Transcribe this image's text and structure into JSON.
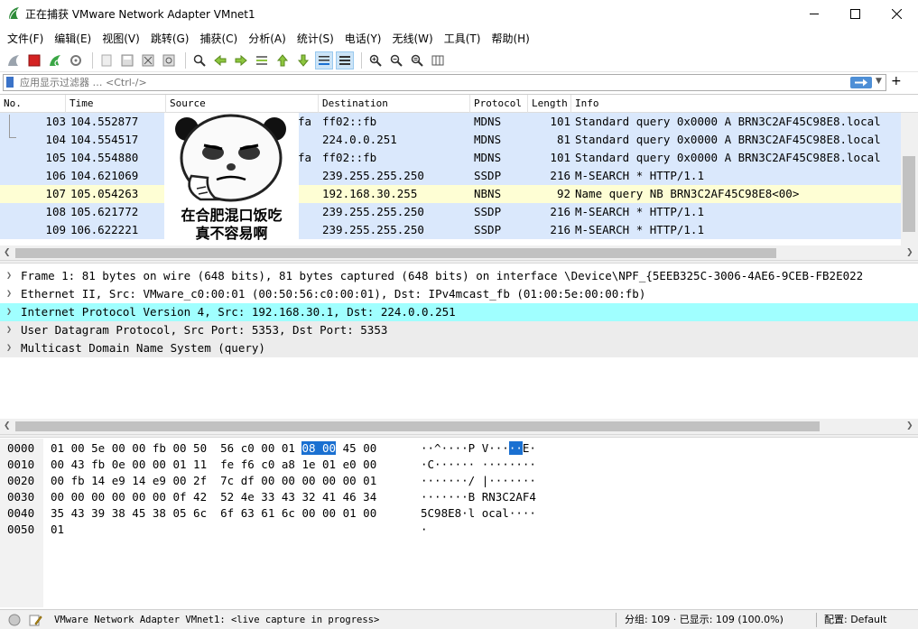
{
  "window": {
    "title": "正在捕获 VMware Network Adapter VMnet1",
    "minimize": "—",
    "maximize": "☐",
    "close": "✕"
  },
  "menu": [
    "文件(F)",
    "编辑(E)",
    "视图(V)",
    "跳转(G)",
    "捕获(C)",
    "分析(A)",
    "统计(S)",
    "电话(Y)",
    "无线(W)",
    "工具(T)",
    "帮助(H)"
  ],
  "filter": {
    "placeholder": "应用显示过滤器 … <Ctrl-/>",
    "apply_icon": "arrow-right-icon",
    "add_label": "+"
  },
  "columns": {
    "no": "No.",
    "time": "Time",
    "source": "Source",
    "destination": "Destination",
    "protocol": "Protocol",
    "length": "Length",
    "info": "Info"
  },
  "packets": [
    {
      "no": "103",
      "time": "104.552877",
      "src": "fa",
      "dst": "ff02::fb",
      "proto": "MDNS",
      "len": "101",
      "info": "Standard query 0x0000 A BRN3C2AF45C98E8.local"
    },
    {
      "no": "104",
      "time": "104.554517",
      "src": "",
      "dst": "224.0.0.251",
      "proto": "MDNS",
      "len": "81",
      "info": "Standard query 0x0000 A BRN3C2AF45C98E8.local"
    },
    {
      "no": "105",
      "time": "104.554880",
      "src": "fa",
      "dst": "ff02::fb",
      "proto": "MDNS",
      "len": "101",
      "info": "Standard query 0x0000 A BRN3C2AF45C98E8.local"
    },
    {
      "no": "106",
      "time": "104.621069",
      "src": "",
      "dst": "239.255.255.250",
      "proto": "SSDP",
      "len": "216",
      "info": "M-SEARCH * HTTP/1.1"
    },
    {
      "no": "107",
      "time": "105.054263",
      "src": "",
      "dst": "192.168.30.255",
      "proto": "NBNS",
      "len": "92",
      "info": "Name query NB BRN3C2AF45C98E8<00>"
    },
    {
      "no": "108",
      "time": "105.621772",
      "src": "",
      "dst": "239.255.255.250",
      "proto": "SSDP",
      "len": "216",
      "info": "M-SEARCH * HTTP/1.1"
    },
    {
      "no": "109",
      "time": "106.622221",
      "src": "",
      "dst": "239.255.255.250",
      "proto": "SSDP",
      "len": "216",
      "info": "M-SEARCH * HTTP/1.1"
    }
  ],
  "meme": {
    "caption_line1": "在合肥混口饭吃",
    "caption_line2": "真不容易啊"
  },
  "details": [
    "Frame 1: 81 bytes on wire (648 bits), 81 bytes captured (648 bits) on interface \\Device\\NPF_{5EEB325C-3006-4AE6-9CEB-FB2E022",
    "Ethernet II, Src: VMware_c0:00:01 (00:50:56:c0:00:01), Dst: IPv4mcast_fb (01:00:5e:00:00:fb)",
    "Internet Protocol Version 4, Src: 192.168.30.1, Dst: 224.0.0.251",
    "User Datagram Protocol, Src Port: 5353, Dst Port: 5353",
    "Multicast Domain Name System (query)"
  ],
  "bytes": {
    "offsets": [
      "0000",
      "0010",
      "0020",
      "0030",
      "0040",
      "0050"
    ],
    "hex": [
      [
        "01 00 5e 00 00 fb 00 50  56 c0 00 01 ",
        "08 00",
        " 45 00"
      ],
      [
        "00 43 fb 0e 00 00 01 11  fe f6 c0 a8 1e 01 e0 00",
        "",
        ""
      ],
      [
        "00 fb 14 e9 14 e9 00 2f  7c df 00 00 00 00 00 01",
        "",
        ""
      ],
      [
        "00 00 00 00 00 00 0f 42  52 4e 33 43 32 41 46 34",
        "",
        ""
      ],
      [
        "35 43 39 38 45 38 05 6c  6f 63 61 6c 00 00 01 00",
        "",
        ""
      ],
      [
        "01",
        "",
        ""
      ]
    ],
    "ascii": [
      [
        "··^····P V···",
        "··",
        "E·"
      ],
      [
        "·C······ ········",
        "",
        ""
      ],
      [
        "·······/ |·······",
        "",
        ""
      ],
      [
        "·······B RN3C2AF4",
        "",
        ""
      ],
      [
        "5C98E8·l ocal····",
        "",
        ""
      ],
      [
        "·",
        "",
        ""
      ]
    ]
  },
  "status": {
    "capture": "VMware Network Adapter VMnet1: <live capture in progress>",
    "packets": "分组: 109 · 已显示: 109 (100.0%)",
    "profile": "配置: Default"
  },
  "colors": {
    "row_blue": "#dae8fc",
    "row_yellow": "#fefed4",
    "row_selected_detail": "#a0ffff",
    "row_grey_detail": "#ececec",
    "hex_highlight": "#1a70d1"
  }
}
